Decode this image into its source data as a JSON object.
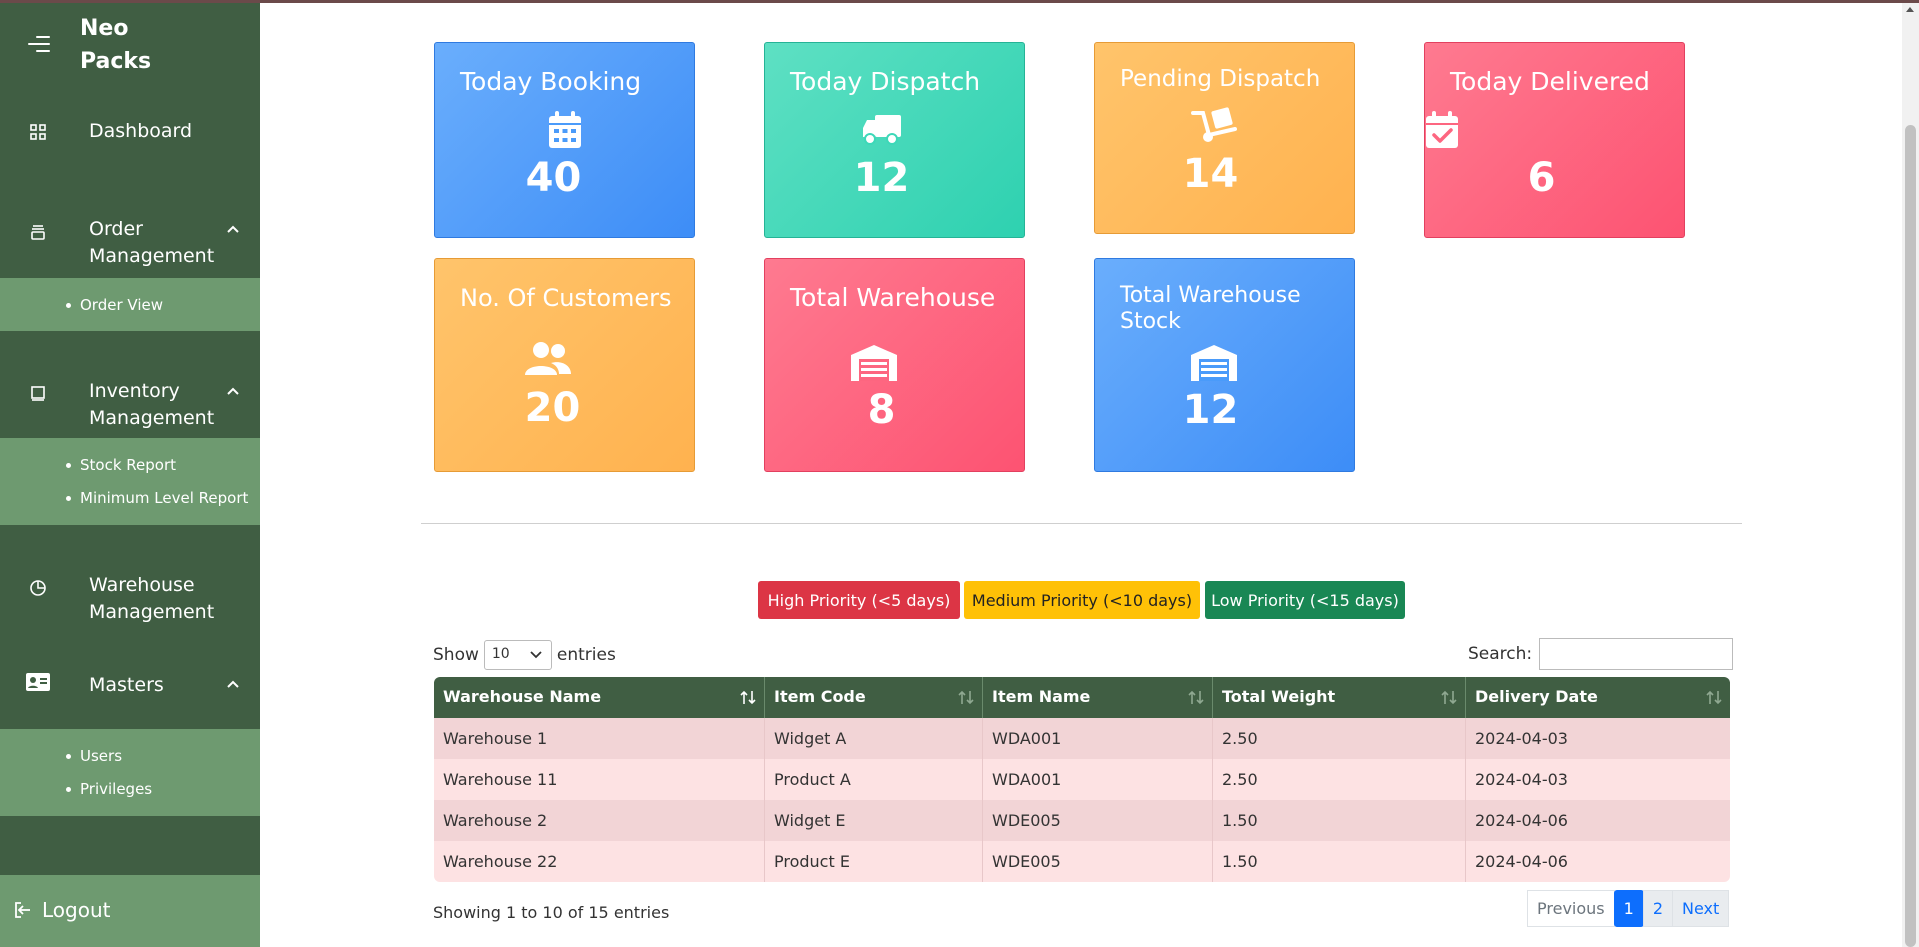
{
  "brand": {
    "name": "Neo Packs"
  },
  "sidebar": {
    "dashboard": "Dashboard",
    "order_management": "Order Management",
    "order_sub": [
      "Order View"
    ],
    "inventory_management": "Inventory Management",
    "inventory_sub": [
      "Stock Report",
      "Minimum Level Report"
    ],
    "warehouse_management": "Warehouse Management",
    "masters": "Masters",
    "masters_sub": [
      "Users",
      "Privileges"
    ],
    "logout": "Logout"
  },
  "cards": {
    "today_booking": {
      "title": "Today Booking",
      "value": "40",
      "icon": "calendar-icon",
      "color": "#4a9bfa"
    },
    "today_dispatch": {
      "title": "Today Dispatch",
      "value": "12",
      "icon": "truck-icon",
      "color": "#3dd8b8"
    },
    "pending_dispatch": {
      "title": "Pending Dispatch",
      "value": "14",
      "icon": "dolly-icon",
      "color": "#ffb95c"
    },
    "today_delivered": {
      "title": "Today Delivered",
      "value": "6",
      "icon": "calendar-check-icon",
      "color": "#fd6680"
    },
    "customers": {
      "title": "No. Of Customers",
      "value": "20",
      "icon": "users-icon",
      "color": "#ffb95c"
    },
    "total_warehouse": {
      "title": "Total Warehouse",
      "value": "8",
      "icon": "warehouse-icon",
      "color": "#fd6680"
    },
    "warehouse_stock": {
      "title": "Total Warehouse Stock",
      "value": "12",
      "icon": "warehouse-icon",
      "color": "#4a9bfa"
    }
  },
  "priority": {
    "high": "High Priority (<5 days)",
    "medium": "Medium Priority (<10 days)",
    "low": "Low Priority (<15 days)"
  },
  "table_controls": {
    "show": "Show",
    "entries_value": "10",
    "entries": "entries",
    "search_label": "Search:"
  },
  "table": {
    "columns": [
      "Warehouse Name",
      "Item Code",
      "Item Name",
      "Total Weight",
      "Delivery Date"
    ],
    "rows": [
      [
        "Warehouse 1",
        "Widget A",
        "WDA001",
        "2.50",
        "2024-04-03"
      ],
      [
        "Warehouse 11",
        "Product A",
        "WDA001",
        "2.50",
        "2024-04-03"
      ],
      [
        "Warehouse 2",
        "Widget E",
        "WDE005",
        "1.50",
        "2024-04-06"
      ],
      [
        "Warehouse 22",
        "Product E",
        "WDE005",
        "1.50",
        "2024-04-06"
      ]
    ]
  },
  "footer": {
    "info": "Showing 1 to 10 of 15 entries",
    "previous": "Previous",
    "page1": "1",
    "page2": "2",
    "next": "Next"
  }
}
